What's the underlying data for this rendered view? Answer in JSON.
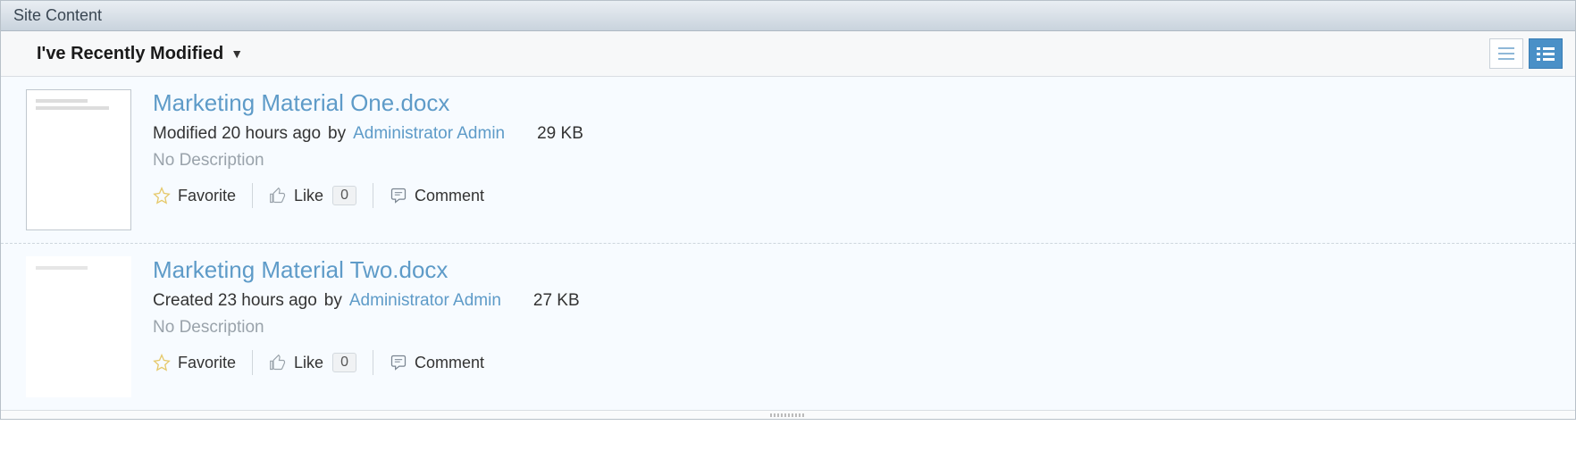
{
  "panel": {
    "title": "Site Content"
  },
  "toolbar": {
    "filter_label": "I've Recently Modified"
  },
  "actions": {
    "favorite": "Favorite",
    "like": "Like",
    "comment": "Comment"
  },
  "documents": [
    {
      "title": "Marketing Material One.docx",
      "meta_prefix": "Modified 20 hours ago",
      "by_label": "by",
      "user": "Administrator Admin",
      "size": "29 KB",
      "description": "No Description",
      "like_count": "0",
      "thumb_style": "full"
    },
    {
      "title": "Marketing Material Two.docx",
      "meta_prefix": "Created 23 hours ago",
      "by_label": "by",
      "user": "Administrator Admin",
      "size": "27 KB",
      "description": "No Description",
      "like_count": "0",
      "thumb_style": "blank"
    }
  ]
}
